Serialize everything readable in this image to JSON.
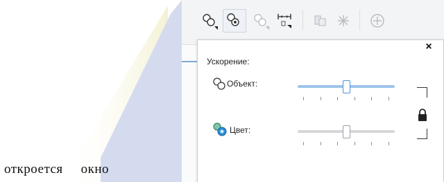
{
  "caption": {
    "word1": "откроется",
    "word2": "окно"
  },
  "toolbar": {
    "buttons": [
      {
        "icon": "blend-object-icon",
        "active": false
      },
      {
        "icon": "blend-color-icon",
        "active": true
      },
      {
        "icon": "blend-disabled-icon",
        "active": false
      },
      {
        "icon": "distribute-icon",
        "active": false
      },
      {
        "icon": "copy-properties-icon",
        "active": false
      },
      {
        "icon": "star-icon",
        "active": false
      },
      {
        "icon": "add-icon",
        "active": false
      }
    ]
  },
  "panel": {
    "title": "Ускорение:",
    "close_label": "×",
    "rows": [
      {
        "label": "Объект:",
        "icon": "object-accel-icon",
        "value": 0.5,
        "linked": true
      },
      {
        "label": "Цвет:",
        "icon": "color-accel-icon",
        "value": 0.5,
        "linked": true
      }
    ],
    "lock_icon": "lock-icon"
  },
  "colors": {
    "accent": "#4a90d9",
    "slider_active": "#9ec4ea",
    "slider_inactive": "#d4d6d8",
    "background_wedge": "#d5dbef",
    "background_glow": "#f3f0cf"
  }
}
